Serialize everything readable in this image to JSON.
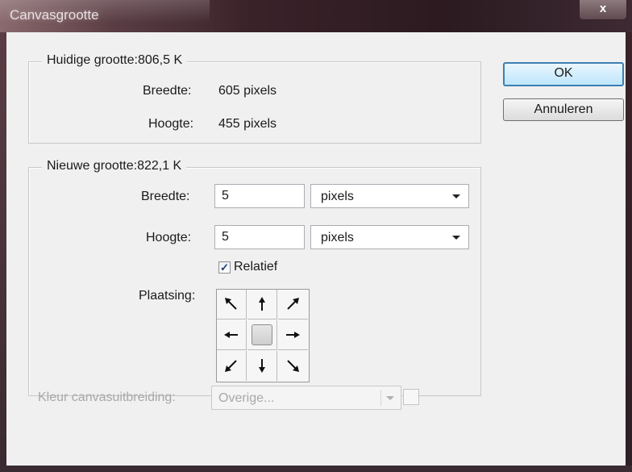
{
  "window": {
    "title": "Canvasgrootte",
    "close_label": "x"
  },
  "current": {
    "legend": "Huidige grootte:806,5 K",
    "width_label": "Breedte:",
    "width_value": "605 pixels",
    "height_label": "Hoogte:",
    "height_value": "455 pixels"
  },
  "new": {
    "legend": "Nieuwe grootte:822,1 K",
    "width_label": "Breedte:",
    "width_value": "5",
    "width_unit": "pixels",
    "height_label": "Hoogte:",
    "height_value": "5",
    "height_unit": "pixels",
    "relative_label": "Relatief",
    "relative_checked": true,
    "anchor_label": "Plaatsing:",
    "anchor_selected": "center"
  },
  "buttons": {
    "ok": "OK",
    "cancel": "Annuleren"
  },
  "extension": {
    "label": "Kleur canvasuitbreiding:",
    "value": "Overige..."
  },
  "colors": {
    "default_button_border": "#3c7fb1",
    "titlebar": "#3a2229"
  }
}
